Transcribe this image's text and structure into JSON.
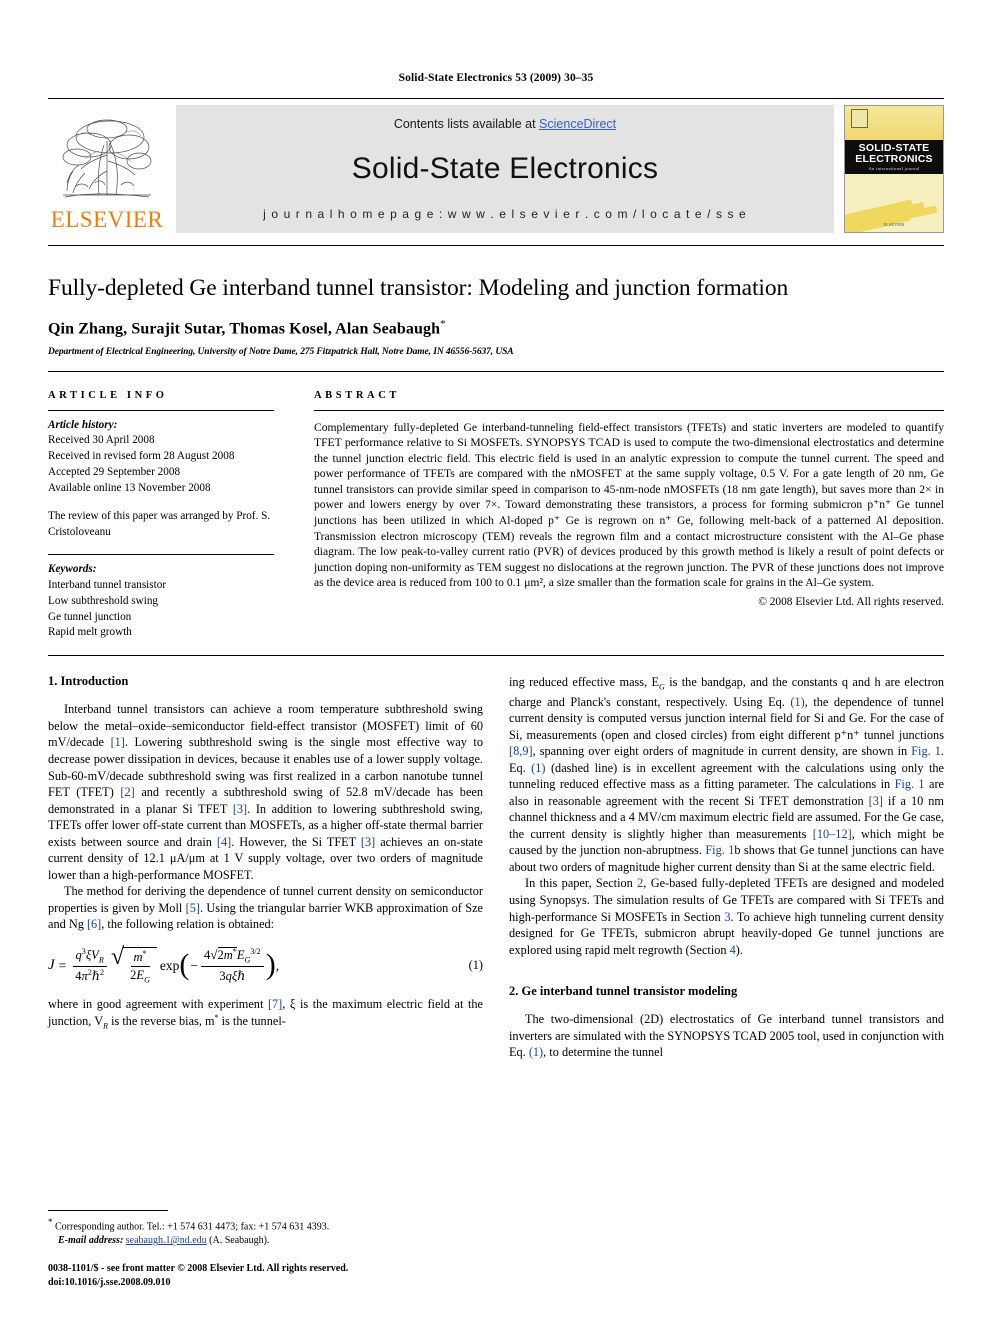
{
  "running_head": "Solid-State Electronics 53 (2009) 30–35",
  "masthead": {
    "publisher": "ELSEVIER",
    "contents_prefix": "Contents lists available at ",
    "contents_link": "ScienceDirect",
    "journal_title": "Solid-State Electronics",
    "homepage": "j o u r n a l   h o m e p a g e :   w w w . e l s e v i e r . c o m / l o c a t e / s s e",
    "cover": {
      "line1": "SOLID-STATE",
      "line2": "ELECTRONICS",
      "tagline": "An international journal",
      "footer": "ELSEVIER"
    }
  },
  "article": {
    "title": "Fully-depleted Ge interband tunnel transistor: Modeling and junction formation",
    "authors": "Qin Zhang, Surajit Sutar, Thomas Kosel, Alan Seabaugh",
    "corresponding_marker": "*",
    "affiliation": "Department of Electrical Engineering, University of Notre Dame, 275 Fitzpatrick Hall, Notre Dame, IN 46556-5637, USA"
  },
  "article_info": {
    "heading": "ARTICLE INFO",
    "history_label": "Article history:",
    "history": [
      "Received 30 April 2008",
      "Received in revised form 28 August 2008",
      "Accepted 29 September 2008",
      "Available online 13 November 2008"
    ],
    "review_note": "The review of this paper was arranged by Prof. S. Cristoloveanu",
    "keywords_label": "Keywords:",
    "keywords": [
      "Interband tunnel transistor",
      "Low subthreshold swing",
      "Ge tunnel junction",
      "Rapid melt growth"
    ]
  },
  "abstract": {
    "heading": "ABSTRACT",
    "text": "Complementary fully-depleted Ge interband-tunneling field-effect transistors (TFETs) and static inverters are modeled to quantify TFET performance relative to Si MOSFETs. SYNOPSYS TCAD is used to compute the two-dimensional electrostatics and determine the tunnel junction electric field. This electric field is used in an analytic expression to compute the tunnel current. The speed and power performance of TFETs are compared with the nMOSFET at the same supply voltage, 0.5 V. For a gate length of 20 nm, Ge tunnel transistors can provide similar speed in comparison to 45-nm-node nMOSFETs (18 nm gate length), but saves more than 2× in power and lowers energy by over 7×. Toward demonstrating these transistors, a process for forming submicron p⁺n⁺ Ge tunnel junctions has been utilized in which Al-doped p⁺ Ge is regrown on n⁺ Ge, following melt-back of a patterned Al deposition. Transmission electron microscopy (TEM) reveals the regrown film and a contact microstructure consistent with the Al–Ge phase diagram. The low peak-to-valley current ratio (PVR) of devices produced by this growth method is likely a result of point defects or junction doping non-uniformity as TEM suggest no dislocations at the regrown junction. The PVR of these junctions does not improve as the device area is reduced from 100 to 0.1 μm², a size smaller than the formation scale for grains in the Al–Ge system.",
    "copyright": "© 2008 Elsevier Ltd. All rights reserved."
  },
  "sections": {
    "intro_heading": "1. Introduction",
    "intro_p1_a": "Interband tunnel transistors can achieve a room temperature subthreshold swing below the metal–oxide–semiconductor field-effect transistor (MOSFET) limit of 60 mV/decade ",
    "intro_p1_ref1": "[1]",
    "intro_p1_b": ". Lowering subthreshold swing is the single most effective way to decrease power dissipation in devices, because it enables use of a lower supply voltage. Sub-60-mV/decade subthreshold swing was first realized in a carbon nanotube tunnel FET (TFET) ",
    "intro_p1_ref2": "[2]",
    "intro_p1_c": " and recently a subthreshold swing of 52.8 mV/decade has been demonstrated in a planar Si TFET ",
    "intro_p1_ref3": "[3]",
    "intro_p1_d": ". In addition to lowering subthreshold swing, TFETs offer lower off-state current than MOSFETs, as a higher off-state thermal barrier exists between source and drain ",
    "intro_p1_ref4": "[4]",
    "intro_p1_e": ". However, the Si TFET ",
    "intro_p1_ref5": "[3]",
    "intro_p1_f": " achieves an on-state current density of 12.1 μA/μm at 1 V supply voltage, over two orders of magnitude lower than a high-performance MOSFET.",
    "intro_p2_a": "The method for deriving the dependence of tunnel current density on semiconductor properties is given by Moll ",
    "intro_p2_ref1": "[5]",
    "intro_p2_b": ". Using the triangular barrier WKB approximation of Sze and Ng ",
    "intro_p2_ref2": "[6]",
    "intro_p2_c": ", the following relation is obtained:",
    "equation_number": "(1)",
    "after_eq_a": "where in good agreement with experiment ",
    "after_eq_ref": "[7]",
    "after_eq_b": ", ξ is the maximum electric field at the junction, V",
    "after_eq_c": " is the reverse bias, m",
    "after_eq_d": " is the tunnel-",
    "right_p1_a": "ing reduced effective mass, E",
    "right_p1_b": " is the bandgap, and the constants q and h are electron charge and Planck's constant, respectively. Using Eq. ",
    "right_p1_eq1": "(1)",
    "right_p1_c": ", the dependence of tunnel current density is computed versus junction internal field for Si and Ge. For the case of Si, measurements (open and closed circles) from eight different p⁺n⁺ tunnel junctions ",
    "right_p1_ref1": "[8,9]",
    "right_p1_d": ", spanning over eight orders of magnitude in current density, are shown in ",
    "right_p1_fig1": "Fig. 1",
    "right_p1_e": ". Eq. ",
    "right_p1_eq2": "(1)",
    "right_p1_f": " (dashed line) is in excellent agreement with the calculations using only the tunneling reduced effective mass as a fitting parameter. The calculations in ",
    "right_p1_fig2": "Fig. 1",
    "right_p1_g": " are also in reasonable agreement with the recent Si TFET demonstration ",
    "right_p1_ref2": "[3]",
    "right_p1_h": " if a 10 nm channel thickness and a 4 MV/cm maximum electric field are assumed. For the Ge case, the current density is slightly higher than measurements ",
    "right_p1_ref3": "[10–12]",
    "right_p1_i": ", which might be caused by the junction non-abruptness. ",
    "right_p1_fig3": "Fig. 1",
    "right_p1_j": "b shows that Ge tunnel junctions can have about two orders of magnitude higher current density than Si at the same electric field.",
    "right_p2_a": "In this paper, Section ",
    "right_p2_sec2": "2",
    "right_p2_b": ", Ge-based fully-depleted TFETs are designed and modeled using Synopsys. The simulation results of Ge TFETs are compared with Si TFETs and high-performance Si MOSFETs in Section ",
    "right_p2_sec3": "3",
    "right_p2_c": ". To achieve high tunneling current density designed for Ge TFETs, submicron abrupt heavily-doped Ge tunnel junctions are explored using rapid melt regrowth (Section ",
    "right_p2_sec4": "4",
    "right_p2_d": ").",
    "sec2_heading": "2. Ge interband tunnel transistor modeling",
    "sec2_p1_a": "The two-dimensional (2D) electrostatics of Ge interband tunnel transistors and inverters are simulated with the SYNOPSYS TCAD 2005 tool, used in conjunction with Eq. ",
    "sec2_p1_eq": "(1)",
    "sec2_p1_b": ", to determine the tunnel"
  },
  "footnote": {
    "star": "*",
    "line1": " Corresponding author. Tel.: +1 574 631 4473; fax: +1 574 631 4393.",
    "email_label": "E-mail address:",
    "email": "seabaugh.1@nd.edu",
    "email_suffix": " (A. Seabaugh).",
    "imprint_line1": "0038-1101/$ - see front matter © 2008 Elsevier Ltd. All rights reserved.",
    "imprint_line2": "doi:10.1016/j.sse.2008.09.010"
  },
  "colors": {
    "link": "#3b5fbe",
    "reference": "#1d3f94",
    "elsevier_orange": "#ef7c10",
    "band_gray": "#e3e3e3"
  }
}
